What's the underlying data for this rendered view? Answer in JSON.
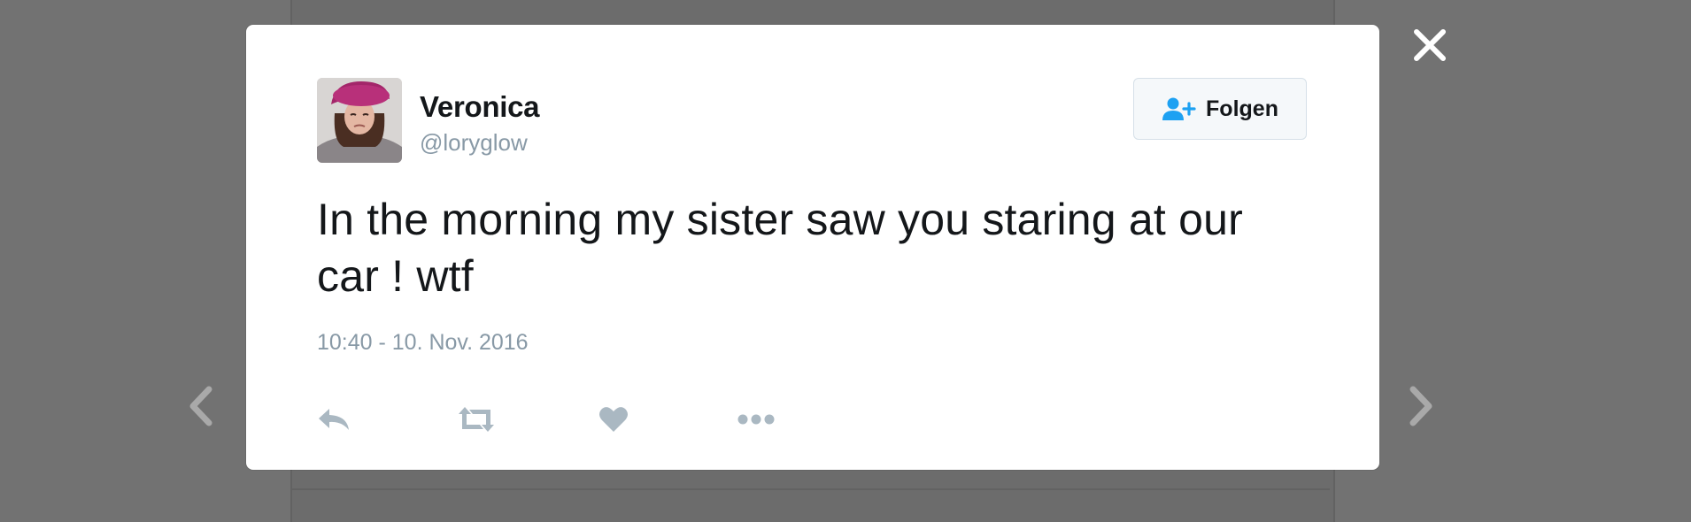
{
  "tweet": {
    "display_name": "Veronica",
    "handle": "@loryglow",
    "text": "In the morning my sister saw you staring at our car ! wtf",
    "timestamp": "10:40 - 10. Nov. 2016",
    "follow_label": "Folgen"
  },
  "icons": {
    "close": "close-icon",
    "prev": "chevron-left-icon",
    "next": "chevron-right-icon",
    "follow": "user-plus-icon",
    "reply": "reply-icon",
    "retweet": "retweet-icon",
    "like": "heart-icon",
    "more": "more-icon"
  },
  "colors": {
    "overlay": "#727272",
    "card": "#ffffff",
    "text": "#14171a",
    "secondary": "#8899a6",
    "accent": "#1da1f2",
    "action_icon": "#aab8c2"
  }
}
